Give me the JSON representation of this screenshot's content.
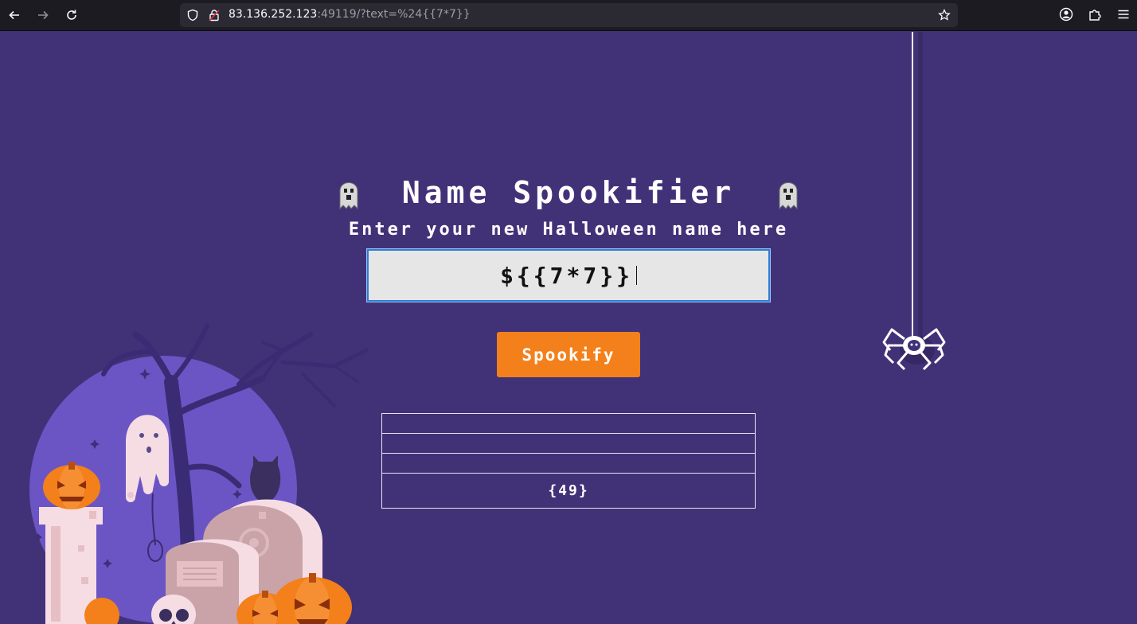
{
  "browser": {
    "url_host": "83.136.252.123",
    "url_rest": ":49119/?text=%24{{7*7}}"
  },
  "page": {
    "title": "Name Spookifier",
    "subtitle": "Enter your new Halloween name here",
    "input_value": "${{7*7}}",
    "button_label": "Spookify",
    "results": [
      "",
      "",
      "",
      "{49}"
    ]
  },
  "colors": {
    "background": "#413278",
    "accent": "#f4801b"
  },
  "icons": [
    "back-arrow-icon",
    "forward-arrow-icon",
    "reload-icon",
    "shield-icon",
    "insecure-lock-icon",
    "star-icon",
    "account-icon",
    "extensions-icon",
    "menu-icon",
    "ghost-icon",
    "spider-icon"
  ]
}
